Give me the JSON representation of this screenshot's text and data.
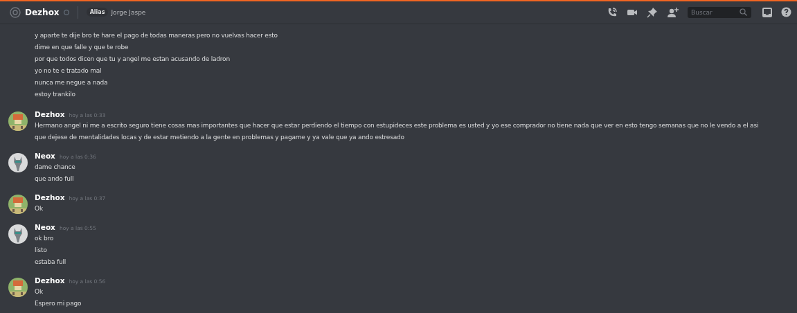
{
  "header": {
    "channel_name": "Dezhox",
    "alias_label": "Alias",
    "alias_value": "Jorge Jaspe",
    "search": {
      "placeholder": "Buscar"
    }
  },
  "groups": [
    {
      "lines": [
        "y aparte te dije bro te hare el pago de todas maneras pero no vuelvas hacer esto",
        "dime en que falle y que te robe",
        "por que todos dicen que tu y angel me estan acusando de ladron",
        "yo no te e tratado mal",
        "nunca me negue a nada",
        "estoy trankilo"
      ]
    },
    {
      "author": "Dezhox",
      "avatar": {
        "kind": "pixel"
      },
      "time": "hoy a las 0:33",
      "lines": [
        "Hermano angel ni me a escrito seguro tiene cosas mas importantes que hacer que estar perdiendo el tiempo con  estupideces este problema es usted y yo ese comprador no tiene nada que ver en esto tengo semanas que no le vendo a el asi que dejese de mentalidades locas y de estar metiendo a la gente en problemas y pagame y ya vale que ya ando estresado"
      ]
    },
    {
      "author": "Neox",
      "avatar": {
        "kind": "animal"
      },
      "time": "hoy a las 0:36",
      "lines": [
        "dame chance",
        "que ando full"
      ]
    },
    {
      "author": "Dezhox",
      "avatar": {
        "kind": "pixel"
      },
      "time": "hoy a las 0:37",
      "lines": [
        "Ok"
      ]
    },
    {
      "author": "Neox",
      "avatar": {
        "kind": "animal"
      },
      "time": "hoy a las 0:55",
      "lines": [
        "ok bro",
        "listo",
        "estaba full"
      ]
    },
    {
      "author": "Dezhox",
      "avatar": {
        "kind": "pixel"
      },
      "time": "hoy a las 0:56",
      "lines": [
        "Ok",
        "Espero mi pago"
      ]
    }
  ]
}
